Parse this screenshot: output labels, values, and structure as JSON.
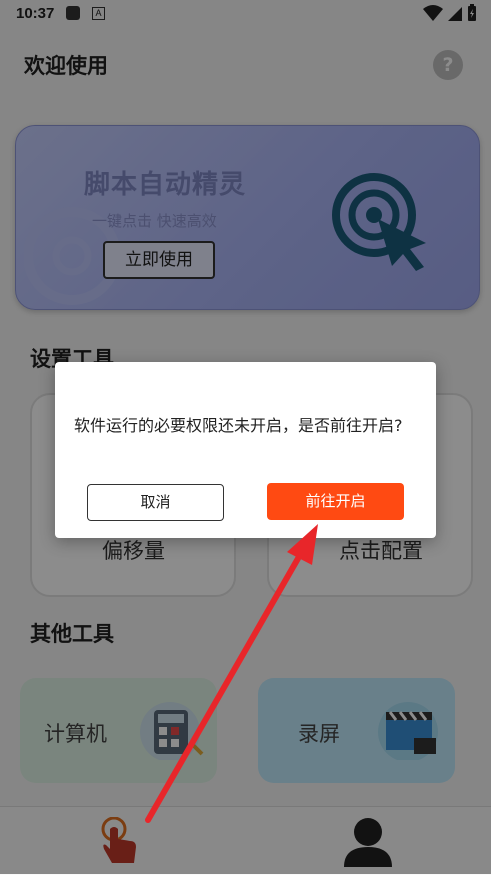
{
  "status_bar": {
    "time": "10:37",
    "app_icon_letter": "A",
    "icons": [
      "square-app-icon",
      "a-icon",
      "wifi-icon",
      "signal-icon",
      "battery-icon"
    ]
  },
  "header": {
    "title": "欢迎使用",
    "help_symbol": "?"
  },
  "banner": {
    "title": "脚本自动精灵",
    "subtitle": "一键点击  快速高效",
    "button_label": "立即使用"
  },
  "settings": {
    "title": "设置工具",
    "cards": [
      {
        "label": "偏移量"
      },
      {
        "label": "点击配置"
      }
    ]
  },
  "other": {
    "title": "其他工具",
    "cards": [
      {
        "label": "计算机",
        "icon": "calculator-icon"
      },
      {
        "label": "录屏",
        "icon": "clapperboard-icon"
      }
    ]
  },
  "bottom_nav": {
    "items": [
      "tap-hand-icon",
      "user-icon"
    ]
  },
  "dialog": {
    "message": "软件运行的必要权限还未开启，是否前往开启?",
    "cancel_label": "取消",
    "confirm_label": "前往开启"
  },
  "colors": {
    "accent": "#ff4a12",
    "arrow": "#e8262a",
    "calc_card": "#dff3e6",
    "record_card": "#bfe9fb",
    "banner": "#aab5f7"
  }
}
